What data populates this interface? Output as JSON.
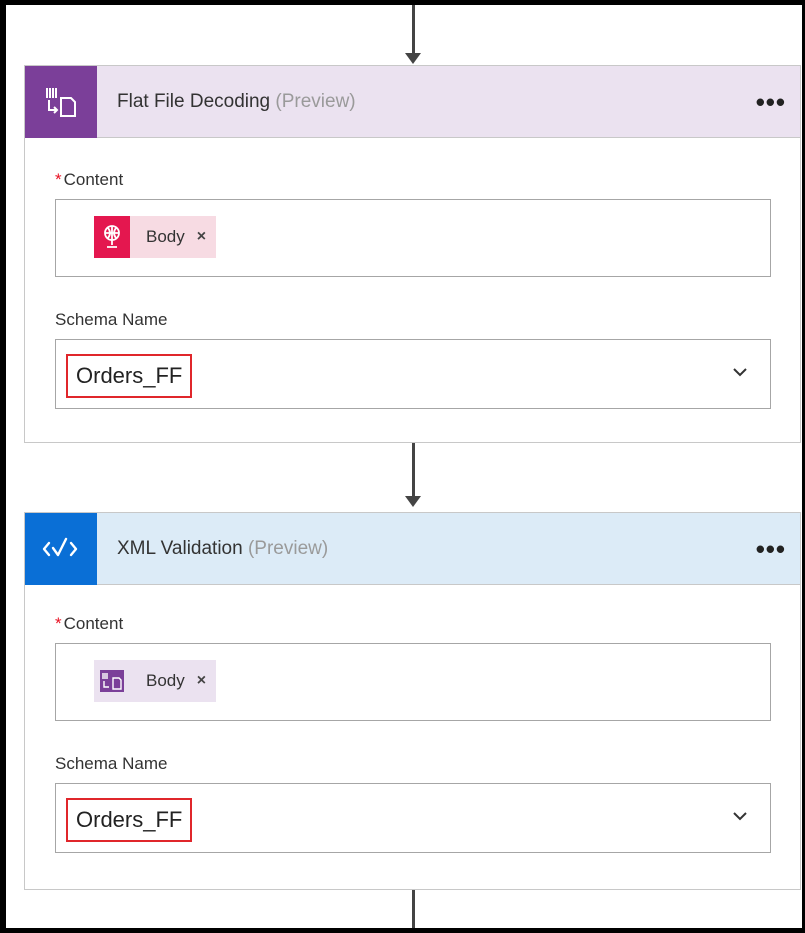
{
  "steps": [
    {
      "title": "Flat File Decoding",
      "preview": "(Preview)",
      "more_label": "•••",
      "content_label": "Content",
      "required_mark": "*",
      "content_token": "Body",
      "token_remove": "×",
      "schema_label": "Schema Name",
      "schema_value": "Orders_FF",
      "icon": "flat-file-icon",
      "accent_color": "#7b3f99",
      "header_color": "#ebe2f0",
      "token_icon": "http-request-icon",
      "token_icon_color": "#e4174f",
      "token_bg": "#f7dbe3"
    },
    {
      "title": "XML Validation",
      "preview": "(Preview)",
      "more_label": "•••",
      "content_label": "Content",
      "required_mark": "*",
      "content_token": "Body",
      "token_remove": "×",
      "schema_label": "Schema Name",
      "schema_value": "Orders_FF",
      "icon": "xml-validation-icon",
      "accent_color": "#0a6fd6",
      "header_color": "#dcebf7",
      "token_icon": "flat-file-icon",
      "token_icon_color": "#7b3f99",
      "token_bg": "#ebe2f0"
    }
  ]
}
